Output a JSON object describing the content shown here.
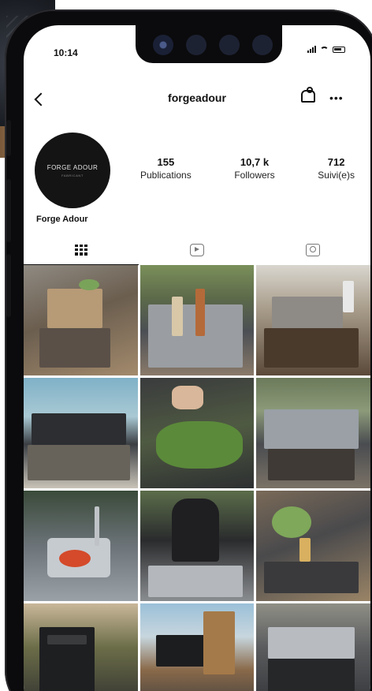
{
  "status_bar": {
    "time": "10:14"
  },
  "header": {
    "username": "forgeadour"
  },
  "profile": {
    "avatar_logo": "FORGE ADOUR",
    "avatar_sub": "FABRICANT",
    "name": "Forge Adour",
    "stats": [
      {
        "value": "155",
        "label": "Publications"
      },
      {
        "value": "10,7 k",
        "label": "Followers"
      },
      {
        "value": "712",
        "label": "Suivi(e)s"
      }
    ]
  },
  "tabs": [
    {
      "name": "posts-grid",
      "icon": "grid-icon"
    },
    {
      "name": "reels",
      "icon": "reels-icon"
    },
    {
      "name": "tagged",
      "icon": "tagged-icon"
    }
  ],
  "posts": [
    {
      "subject": "outdoor kitchen cart with cutting board"
    },
    {
      "subject": "stainless grill module with bottles"
    },
    {
      "subject": "grill plancha on wooden unit"
    },
    {
      "subject": "outdoor kitchen by the pool"
    },
    {
      "subject": "hands cooking green vegetables on plancha"
    },
    {
      "subject": "plancha kitchen in garden"
    },
    {
      "subject": "washing vegetables at outdoor sink"
    },
    {
      "subject": "woman cooking in apron"
    },
    {
      "subject": "drinks and salad on counter"
    },
    {
      "subject": "black cabinet in garden"
    },
    {
      "subject": "opened plancha module with wood"
    },
    {
      "subject": "stainless steel grill unit"
    }
  ]
}
